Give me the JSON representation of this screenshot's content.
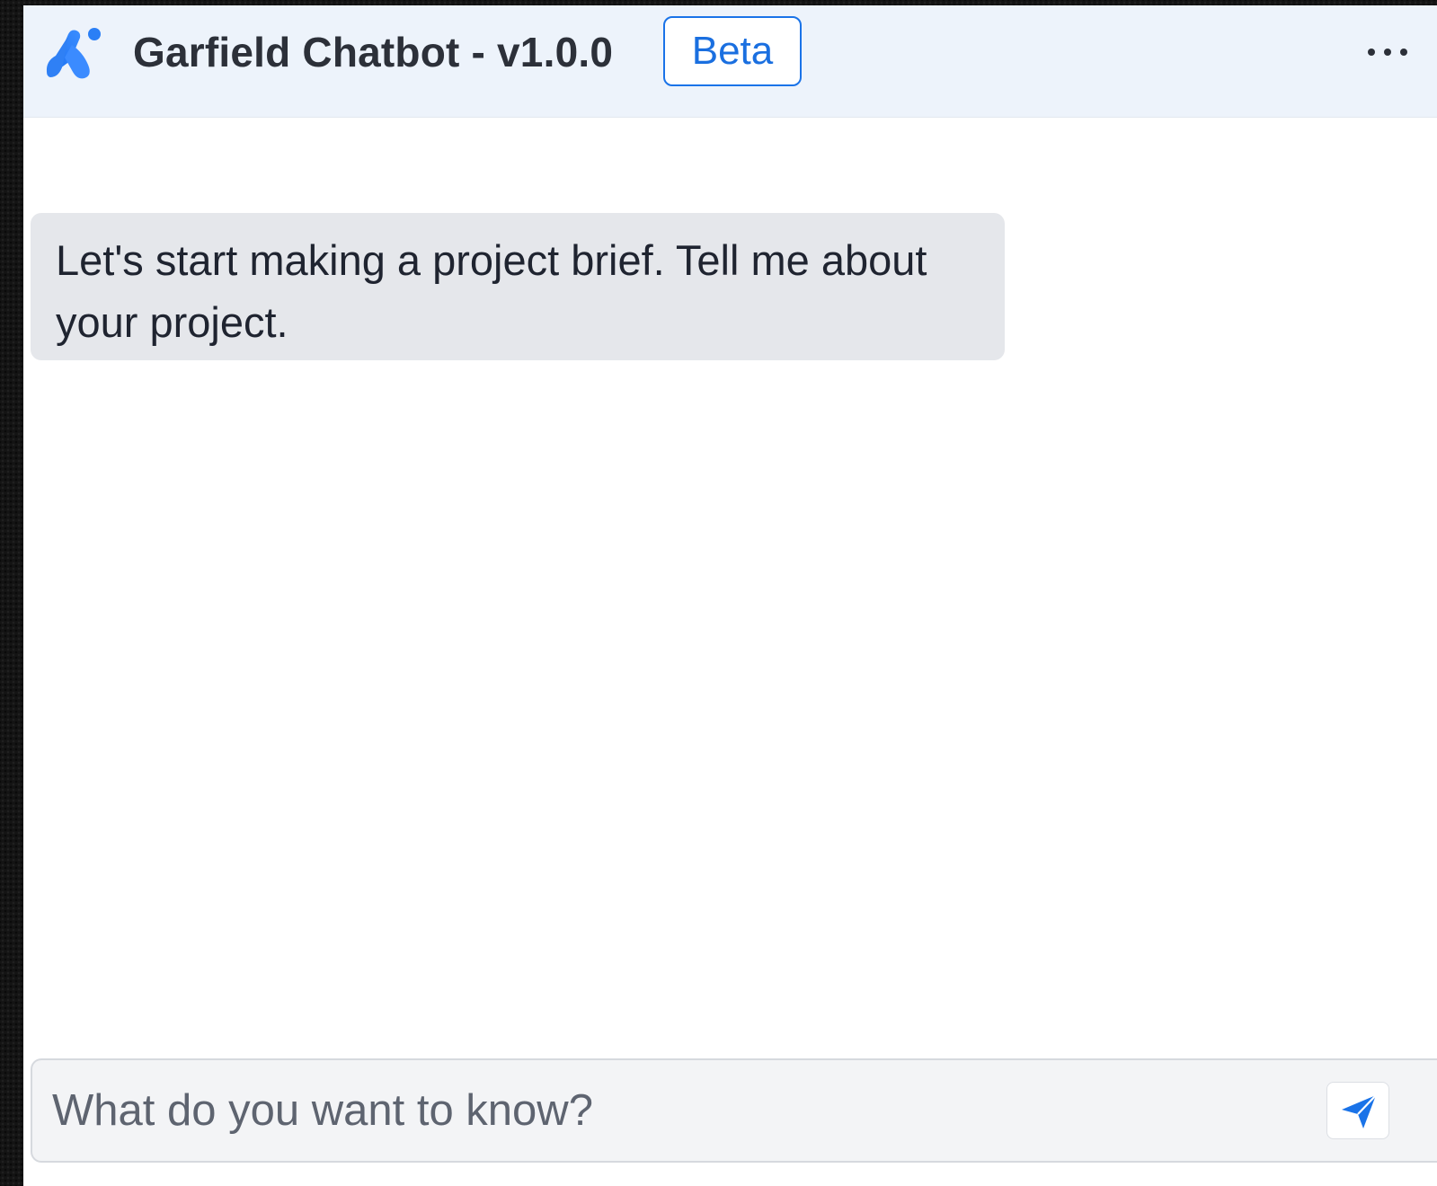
{
  "header": {
    "logo_icon": "app-logo-icon",
    "title": "Garfield Chatbot - v1.0.0",
    "badge": "Beta",
    "menu_icon": "more-horizontal-icon"
  },
  "messages": [
    {
      "role": "bot",
      "text": "Let's start making a project brief. Tell me about your project."
    }
  ],
  "composer": {
    "value": "",
    "placeholder": "What do you want to know?",
    "send_icon": "send-icon"
  },
  "colors": {
    "accent": "#1a73e8",
    "header_background": "#edf3fb",
    "bot_bubble_background": "#e5e7eb",
    "composer_background": "#f3f4f6",
    "desktop_background": "#141414"
  }
}
